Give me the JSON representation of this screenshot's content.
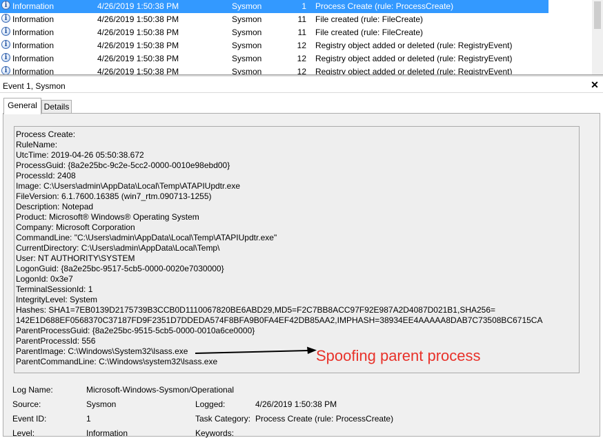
{
  "events": [
    {
      "level": "Information",
      "date": "4/26/2019 1:50:38 PM",
      "source": "Sysmon",
      "event_id": "1",
      "task": "Process Create (rule: ProcessCreate)",
      "selected": true
    },
    {
      "level": "Information",
      "date": "4/26/2019 1:50:38 PM",
      "source": "Sysmon",
      "event_id": "11",
      "task": "File created (rule: FileCreate)",
      "selected": false
    },
    {
      "level": "Information",
      "date": "4/26/2019 1:50:38 PM",
      "source": "Sysmon",
      "event_id": "11",
      "task": "File created (rule: FileCreate)",
      "selected": false
    },
    {
      "level": "Information",
      "date": "4/26/2019 1:50:38 PM",
      "source": "Sysmon",
      "event_id": "12",
      "task": "Registry object added or deleted (rule: RegistryEvent)",
      "selected": false
    },
    {
      "level": "Information",
      "date": "4/26/2019 1:50:38 PM",
      "source": "Sysmon",
      "event_id": "12",
      "task": "Registry object added or deleted (rule: RegistryEvent)",
      "selected": false
    },
    {
      "level": "Information",
      "date": "4/26/2019 1:50:38 PM",
      "source": "Sysmon",
      "event_id": "12",
      "task": "Registry object added or deleted (rule: RegistryEvent)",
      "selected": false
    }
  ],
  "detail": {
    "title": "Event 1, Sysmon",
    "tabs": [
      "General",
      "Details"
    ],
    "active_tab": "General"
  },
  "description_lines": [
    "Process Create:",
    "RuleName:",
    "UtcTime: 2019-04-26 05:50:38.672",
    "ProcessGuid: {8a2e25bc-9c2e-5cc2-0000-0010e98ebd00}",
    "ProcessId: 2408",
    "Image: C:\\Users\\admin\\AppData\\Local\\Temp\\ATAPIUpdtr.exe",
    "FileVersion: 6.1.7600.16385 (win7_rtm.090713-1255)",
    "Description: Notepad",
    "Product: Microsoft® Windows® Operating System",
    "Company: Microsoft Corporation",
    "CommandLine: \"C:\\Users\\admin\\AppData\\Local\\Temp\\ATAPIUpdtr.exe\"",
    "CurrentDirectory: C:\\Users\\admin\\AppData\\Local\\Temp\\",
    "User: NT AUTHORITY\\SYSTEM",
    "LogonGuid: {8a2e25bc-9517-5cb5-0000-0020e7030000}",
    "LogonId: 0x3e7",
    "TerminalSessionId: 1",
    "IntegrityLevel: System",
    "Hashes: SHA1=7EB0139D2175739B3CCB0D1110067820BE6ABD29,MD5=F2C7BB8ACC97F92E987A2D4087D021B1,SHA256=",
    "142E1D688EF0568370C37187FD9F2351D7DDEDA574F8BFA9B0FA4EF42DB85AA2,IMPHASH=38934EE4AAAAA8DAB7C73508BC6715CA",
    "ParentProcessGuid: {8a2e25bc-9515-5cb5-0000-0010a6ce0000}",
    "ParentProcessId: 556",
    "ParentImage: C:\\Windows\\System32\\lsass.exe",
    "ParentCommandLine: C:\\Windows\\system32\\lsass.exe"
  ],
  "annotation": {
    "text": "Spoofing parent process",
    "color": "#e8322a"
  },
  "properties": {
    "log_name_label": "Log Name:",
    "log_name_value": "Microsoft-Windows-Sysmon/Operational",
    "source_label": "Source:",
    "source_value": "Sysmon",
    "logged_label": "Logged:",
    "logged_value": "4/26/2019 1:50:38 PM",
    "event_id_label": "Event ID:",
    "event_id_value": "1",
    "task_category_label": "Task Category:",
    "task_category_value": "Process Create (rule: ProcessCreate)",
    "level_label": "Level:",
    "level_value": "Information",
    "keywords_label": "Keywords:"
  },
  "colors": {
    "selection": "#3399ff",
    "panel_background": "#f0f0f0"
  }
}
